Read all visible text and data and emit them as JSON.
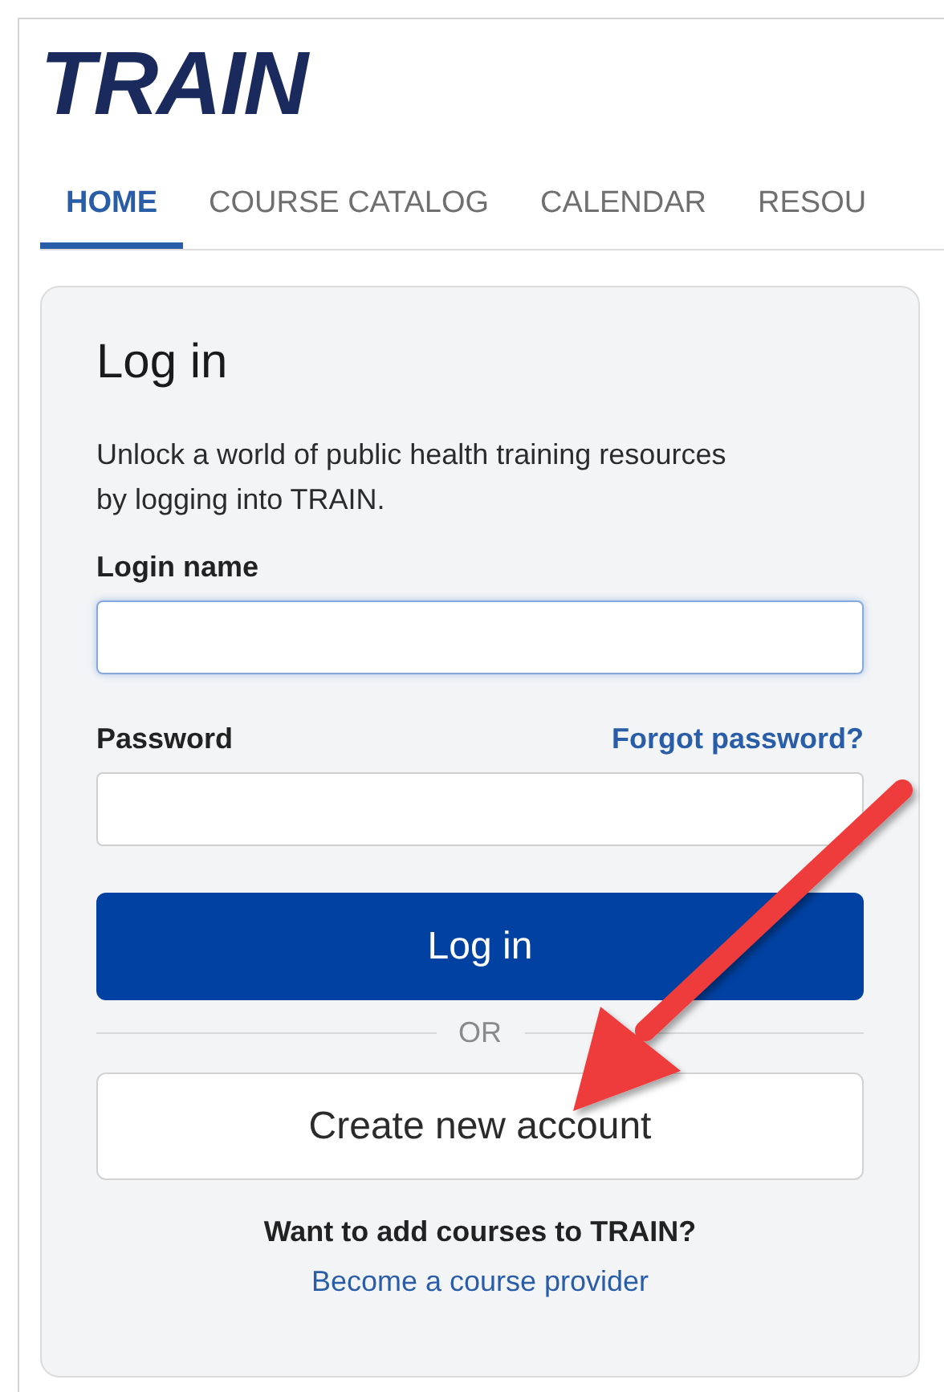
{
  "logo": "TRAIN",
  "tabs": [
    {
      "label": "HOME",
      "selected": true
    },
    {
      "label": "COURSE CATALOG",
      "selected": false
    },
    {
      "label": "CALENDAR",
      "selected": false
    },
    {
      "label": "RESOU",
      "selected": false
    }
  ],
  "login": {
    "title": "Log in",
    "description": "Unlock a world of public health training resources by logging into TRAIN.",
    "fields": [
      {
        "label": "Login name",
        "focused": true
      },
      {
        "label": "Password",
        "focused": false,
        "link": "Forgot password?"
      }
    ],
    "submit": "Log in",
    "divider": "OR",
    "create": "Create new account",
    "provider_prompt": "Want to add courses to TRAIN?",
    "provider_link": "Become a course provider"
  }
}
